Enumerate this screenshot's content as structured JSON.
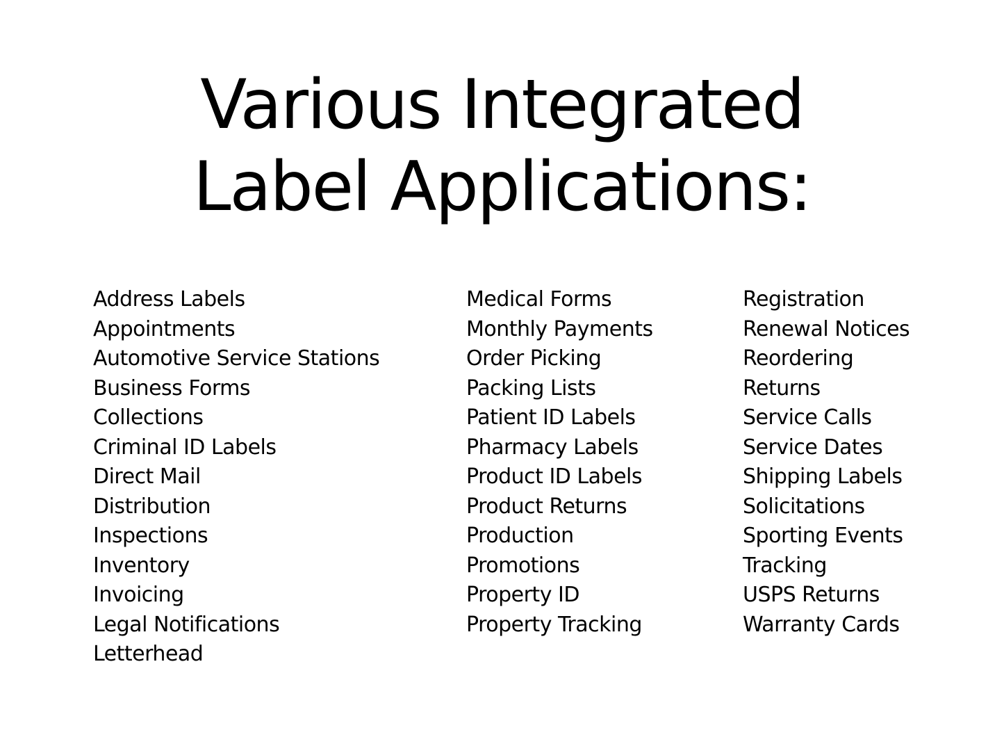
{
  "title": {
    "line1": "Various Integrated",
    "line2": "Label Applications:"
  },
  "columns": [
    [
      "Address Labels",
      "Appointments",
      "Automotive Service Stations",
      "Business Forms",
      "Collections",
      "Criminal ID Labels",
      "Direct Mail",
      "Distribution",
      "Inspections",
      "Inventory",
      "Invoicing",
      "Legal Notifications",
      "Letterhead"
    ],
    [
      "Medical Forms",
      "Monthly Payments",
      "Order Picking",
      "Packing Lists",
      "Patient ID Labels",
      "Pharmacy Labels",
      "Product ID Labels",
      "Product Returns",
      "Production",
      "Promotions",
      "Property ID",
      "Property Tracking"
    ],
    [
      "Registration",
      "Renewal Notices",
      "Reordering",
      "Returns",
      "Service Calls",
      "Service Dates",
      "Shipping Labels",
      "Solicitations",
      "Sporting Events",
      "Tracking",
      "USPS Returns",
      "Warranty Cards"
    ]
  ]
}
